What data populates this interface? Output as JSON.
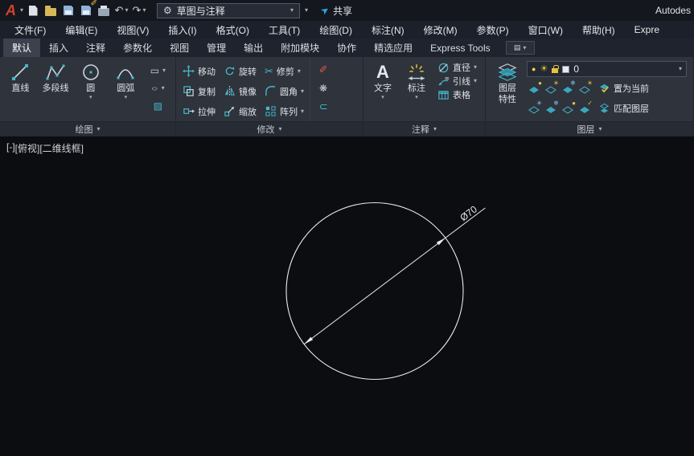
{
  "titlebar": {
    "logo": "A",
    "workspace": "草图与注释",
    "share": "共享",
    "right_text": "Autodes"
  },
  "menubar": {
    "items": [
      "文件(F)",
      "编辑(E)",
      "视图(V)",
      "插入(I)",
      "格式(O)",
      "工具(T)",
      "绘图(D)",
      "标注(N)",
      "修改(M)",
      "参数(P)",
      "窗口(W)",
      "帮助(H)",
      "Expre"
    ]
  },
  "ribbon": {
    "tabs": [
      "默认",
      "插入",
      "注释",
      "参数化",
      "视图",
      "管理",
      "输出",
      "附加模块",
      "协作",
      "精选应用",
      "Express Tools"
    ],
    "active_tab": "默认",
    "panels": {
      "draw": {
        "label": "绘图",
        "big_buttons": [
          "直线",
          "多段线",
          "圆",
          "圆弧"
        ]
      },
      "modify": {
        "label": "修改",
        "buttons": [
          "移动",
          "旋转",
          "修剪",
          "复制",
          "镜像",
          "圆角",
          "拉伸",
          "缩放",
          "阵列"
        ]
      },
      "annotate": {
        "label": "注释",
        "big_buttons": [
          "文字",
          "标注"
        ],
        "small_buttons": [
          "直径",
          "引线",
          "表格"
        ]
      },
      "layers": {
        "label": "图层",
        "big_button_line1": "图层",
        "big_button_line2": "特性",
        "current_layer": "0",
        "buttons": [
          "置为当前",
          "匹配图层"
        ],
        "tools": [
          {
            "glyph": "●"
          },
          {
            "glyph": "☀"
          },
          {
            "glyph": "❄"
          },
          {
            "glyph": "☀"
          },
          {
            "glyph": "☀"
          },
          {
            "glyph": "❄"
          },
          {
            "glyph": "●"
          },
          {
            "glyph": "✓"
          }
        ]
      }
    }
  },
  "canvas": {
    "viewport_controls": [
      "[-]",
      "[俯视]",
      "[二维线框]"
    ],
    "drawing": {
      "shape": "circle-with-diameter-dimension",
      "dimension_label": "Ø70"
    }
  },
  "glyphs": {
    "caret": "▾",
    "gear": "⚙",
    "plane": "➤",
    "undo": "↶",
    "redo": "↷",
    "scissors": "✂",
    "pencil": "✐",
    "explode": "❋",
    "join": "⊂",
    "rect": "▭",
    "ellipse": "○",
    "hatch": "▨",
    "sun": "☀",
    "bulb": "●",
    "panel_box": "▤"
  }
}
